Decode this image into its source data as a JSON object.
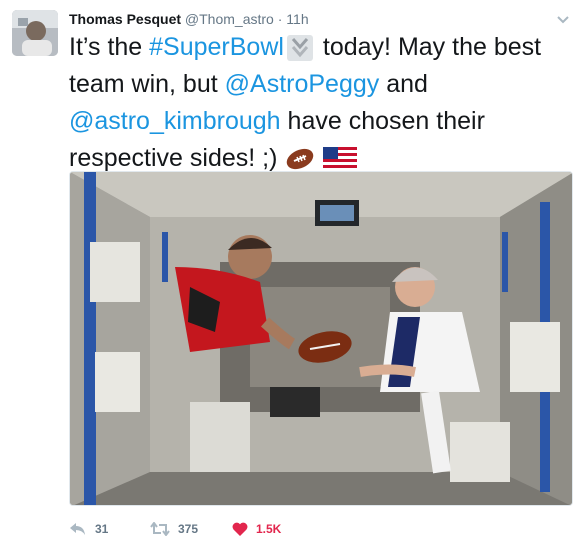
{
  "tweet": {
    "author_name": "Thomas Pesquet",
    "author_handle": "@Thom_astro",
    "separator": "·",
    "time": "11h",
    "text_1": "It’s the ",
    "hashtag": "#SuperBowl",
    "text_2": " today! May the best team win, but ",
    "mention_1": "@AstroPeggy",
    "text_3": " and ",
    "mention_2": "@astro_kimbrough",
    "text_4": " have chosen their respective sides! ;) ",
    "emojis": [
      "football-emoji",
      "us-flag-emoji"
    ],
    "photo_icon": "astronauts-with-football-photo"
  },
  "actions": {
    "reply_count": "31",
    "retweet_count": "375",
    "like_count": "1.5K"
  },
  "colors": {
    "link": "#1b95e0",
    "muted": "#657786",
    "like": "#e2264d"
  }
}
